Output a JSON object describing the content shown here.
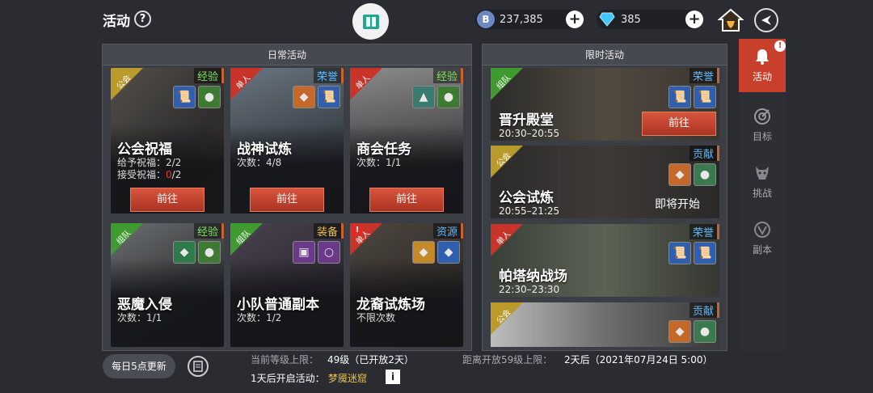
{
  "header": {
    "title": "活动",
    "help": "?",
    "currency_silver": "237,385",
    "currency_diamond": "385",
    "plus": "+"
  },
  "daily": {
    "title": "日常活动",
    "go_label": "前往",
    "cards": [
      {
        "tag": "公会",
        "reward": "经验",
        "name": "公会祝福",
        "line1": "给予祝福：2/2",
        "line2_prefix": "接受祝福：",
        "line2_red": "0",
        "line2_suffix": "/2"
      },
      {
        "tag": "单人",
        "reward": "荣誉",
        "name": "战神试炼",
        "line1": "次数：4/8"
      },
      {
        "tag": "单人",
        "reward": "经验",
        "name": "商会任务",
        "line1": "次数：1/1"
      },
      {
        "tag": "组队",
        "reward": "经验",
        "name": "恶魔入侵",
        "line1": "次数：1/1"
      },
      {
        "tag": "组队",
        "reward": "装备",
        "name": "小队普通副本",
        "line1": "次数：1/2"
      },
      {
        "tag": "单人",
        "reward": "资源",
        "name": "龙裔试炼场",
        "line1": "不限次数",
        "alert": "!"
      }
    ]
  },
  "limited": {
    "title": "限时活动",
    "cards": [
      {
        "tag": "组队",
        "reward": "荣誉",
        "name": "晋升殿堂",
        "time": "20:30–20:55",
        "action": "前往"
      },
      {
        "tag": "公会",
        "reward": "贡献",
        "name": "公会试炼",
        "time": "20:55–21:25",
        "status": "即将开始"
      },
      {
        "tag": "单人",
        "reward": "荣誉",
        "name": "帕塔纳战场",
        "time": "22:30–23:30"
      },
      {
        "tag": "公会",
        "reward": "贡献"
      }
    ]
  },
  "sidenav": {
    "items": [
      "活动",
      "目标",
      "挑战",
      "副本"
    ],
    "alert": "!"
  },
  "footer": {
    "refresh_button": "每日5点更新",
    "level_label": "当前等级上限：",
    "level_value": "49级（已开放2天）",
    "next_label": "距离开放59级上限：",
    "next_value": "2天后（2021年07月24日 5:00）",
    "upcoming_prefix": "1天后开启活动：",
    "upcoming_name": "梦魇迷窟",
    "info": "i"
  },
  "colors": {
    "accent_red": "#c8402c",
    "tag_green": "#3f9a2f",
    "tag_red": "#c8332a",
    "tag_gold": "#b99a2a",
    "reward_green": "#7de05b",
    "reward_blue": "#5fb8ff",
    "reward_gold": "#e8c04a"
  },
  "icons": [
    "question-icon",
    "book-icon",
    "coin-b-icon",
    "diamond-icon",
    "plus-icon",
    "home-icon",
    "back-arrow-icon",
    "bell-icon",
    "target-icon",
    "demon-icon",
    "shield-icon",
    "notepad-icon",
    "info-icon"
  ]
}
